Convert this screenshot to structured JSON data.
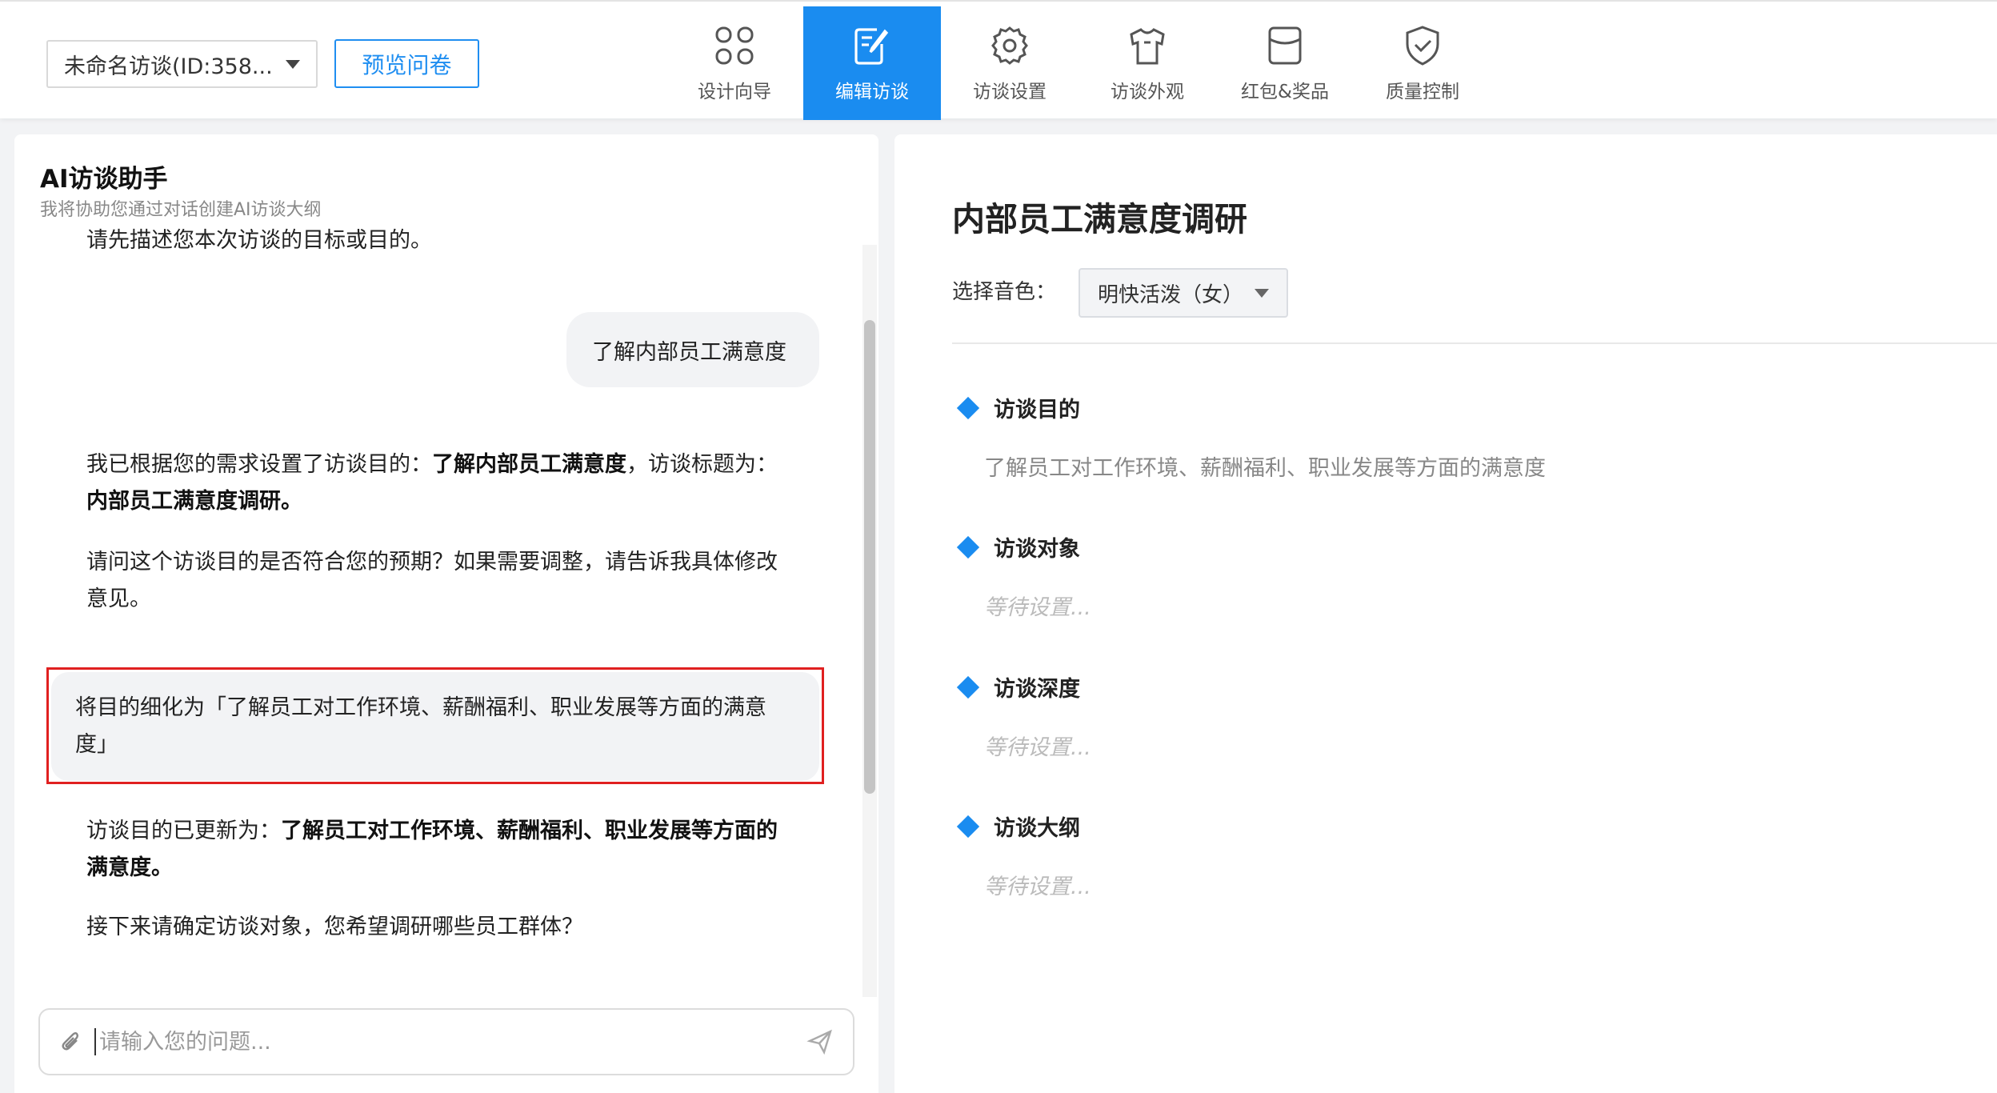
{
  "header": {
    "survey_select": "未命名访谈(ID:358...",
    "preview_button": "预览问卷",
    "nav": [
      {
        "label": "设计向导",
        "icon": "grid-icon",
        "active": false
      },
      {
        "label": "编辑访谈",
        "icon": "edit-icon",
        "active": true
      },
      {
        "label": "访谈设置",
        "icon": "gear-icon",
        "active": false
      },
      {
        "label": "访谈外观",
        "icon": "shirt-icon",
        "active": false
      },
      {
        "label": "红包&奖品",
        "icon": "envelope-icon",
        "active": false
      },
      {
        "label": "质量控制",
        "icon": "shield-check-icon",
        "active": false
      }
    ]
  },
  "assistant": {
    "title": "AI访谈助手",
    "subtitle": "我将协助您通过对话创建AI访谈大纲",
    "messages": {
      "m1": "请先描述您本次访谈的目标或目的。",
      "u1": "了解内部员工满意度",
      "m2_a": "我已根据您的需求设置了访谈目的：",
      "m2_b": "了解内部员工满意度",
      "m2_c": "，访谈标题为：",
      "m2_d": "内部员工满意度调研。",
      "m3_a": "请问这个访谈目的是否符合您的预期？如果需要调整，请告诉我具体修改",
      "m3_b": "意见。",
      "u2_a": "将目的细化为「了解员工对工作环境、薪酬福利、职业发展等方面的满意",
      "u2_b": "度」",
      "m4_a": "访谈目的已更新为：",
      "m4_b": "了解员工对工作环境、薪酬福利、职业发展等方面的",
      "m4_c": "满意度。",
      "m5": "接下来请确定访谈对象，您希望调研哪些员工群体？"
    },
    "input_placeholder": "请输入您的问题..."
  },
  "survey": {
    "title": "内部员工满意度调研",
    "voice_label": "选择音色：",
    "voice_value": "明快活泼（女）",
    "sections": [
      {
        "title": "访谈目的",
        "body": "了解员工对工作环境、薪酬福利、职业发展等方面的满意度"
      },
      {
        "title": "访谈对象",
        "body": "等待设置..."
      },
      {
        "title": "访谈深度",
        "body": "等待设置..."
      },
      {
        "title": "访谈大纲",
        "body": "等待设置..."
      }
    ]
  },
  "colors": {
    "accent": "#1a8cf0",
    "highlight": "#e02020",
    "bubble": "#f2f3f5"
  }
}
